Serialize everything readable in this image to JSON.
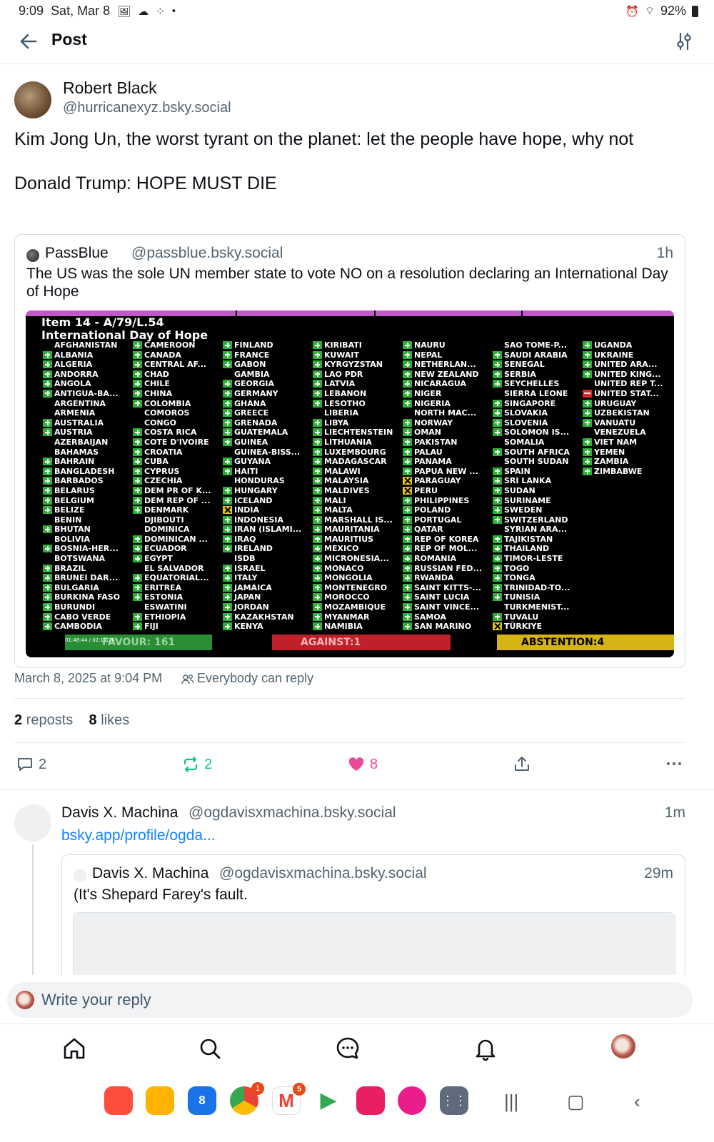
{
  "status_bar": {
    "time": "9:09",
    "date": "Sat, Mar 8",
    "battery": "92%"
  },
  "header": {
    "title": "Post"
  },
  "post": {
    "author_name": "Robert Black",
    "author_handle": "@hurricanexyz.bsky.social",
    "text": "Kim Jong Un, the worst tyrant on the planet: let the people have hope, why not\n\nDonald Trump: HOPE MUST DIE",
    "quote": {
      "name": "PassBlue",
      "handle": "@passblue.bsky.social",
      "time": "1h",
      "text": "The US was the sole UN member state to vote NO on a resolution declaring an International Day of Hope"
    },
    "date": "March 8, 2025 at 9:04 PM",
    "reply_setting": "Everybody can reply",
    "reposts_count": "2",
    "reposts_label": "reposts",
    "likes_count": "8",
    "likes_label": "likes",
    "actions": {
      "replies": "2",
      "reposts": "2",
      "likes": "8"
    }
  },
  "vote_image": {
    "title": "Item 14 - A/79/L.54\nInternational Day of Hope",
    "totals": {
      "favour": "FAVOUR: 161",
      "against": "AGAINST:1",
      "abstention": "ABSTENTION:4"
    },
    "timestamp": "01:48:44 / 02:17:28",
    "columns": [
      [
        [
          "AFGHANISTAN",
          ""
        ],
        [
          "ALBANIA",
          "y"
        ],
        [
          "ALGERIA",
          "y"
        ],
        [
          "ANDORRA",
          "y"
        ],
        [
          "ANGOLA",
          "y"
        ],
        [
          "ANTIGUA-BA...",
          "y"
        ],
        [
          "ARGENTINA",
          ""
        ],
        [
          "ARMENIA",
          ""
        ],
        [
          "AUSTRALIA",
          "y"
        ],
        [
          "AUSTRIA",
          "y"
        ],
        [
          "AZERBAIJAN",
          ""
        ],
        [
          "BAHAMAS",
          ""
        ],
        [
          "BAHRAIN",
          "y"
        ],
        [
          "BANGLADESH",
          "y"
        ],
        [
          "BARBADOS",
          "y"
        ],
        [
          "BELARUS",
          "y"
        ],
        [
          "BELGIUM",
          "y"
        ],
        [
          "BELIZE",
          "y"
        ],
        [
          "BENIN",
          ""
        ],
        [
          "BHUTAN",
          "y"
        ],
        [
          "BOLIVIA",
          ""
        ],
        [
          "BOSNIA-HER...",
          "y"
        ],
        [
          "BOTSWANA",
          ""
        ],
        [
          "BRAZIL",
          "y"
        ],
        [
          "BRUNEI DAR...",
          "y"
        ],
        [
          "BULGARIA",
          "y"
        ],
        [
          "BURKINA FASO",
          "y"
        ],
        [
          "BURUNDI",
          "y"
        ],
        [
          "CABO VERDE",
          "y"
        ],
        [
          "CAMBODIA",
          "y"
        ]
      ],
      [
        [
          "CAMEROON",
          "y"
        ],
        [
          "CANADA",
          "y"
        ],
        [
          "CENTRAL AF...",
          "y"
        ],
        [
          "CHAD",
          "y"
        ],
        [
          "CHILE",
          "y"
        ],
        [
          "CHINA",
          "y"
        ],
        [
          "COLOMBIA",
          "y"
        ],
        [
          "COMOROS",
          ""
        ],
        [
          "CONGO",
          ""
        ],
        [
          "COSTA RICA",
          "y"
        ],
        [
          "COTE D'IVOIRE",
          "y"
        ],
        [
          "CROATIA",
          "y"
        ],
        [
          "CUBA",
          "y"
        ],
        [
          "CYPRUS",
          "y"
        ],
        [
          "CZECHIA",
          "y"
        ],
        [
          "DEM PR OF K...",
          "y"
        ],
        [
          "DEM REP OF ...",
          "y"
        ],
        [
          "DENMARK",
          "y"
        ],
        [
          "DJIBOUTI",
          ""
        ],
        [
          "DOMINICA",
          ""
        ],
        [
          "DOMINICAN ...",
          "y"
        ],
        [
          "ECUADOR",
          "y"
        ],
        [
          "EGYPT",
          "y"
        ],
        [
          "EL SALVADOR",
          ""
        ],
        [
          "EQUATORIAL...",
          "y"
        ],
        [
          "ERITREA",
          "y"
        ],
        [
          "ESTONIA",
          "y"
        ],
        [
          "ESWATINI",
          ""
        ],
        [
          "ETHIOPIA",
          "y"
        ],
        [
          "FIJI",
          "y"
        ]
      ],
      [
        [
          "FINLAND",
          "y"
        ],
        [
          "FRANCE",
          "y"
        ],
        [
          "GABON",
          "y"
        ],
        [
          "GAMBIA",
          ""
        ],
        [
          "GEORGIA",
          "y"
        ],
        [
          "GERMANY",
          "y"
        ],
        [
          "GHANA",
          "y"
        ],
        [
          "GREECE",
          "y"
        ],
        [
          "GRENADA",
          "y"
        ],
        [
          "GUATEMALA",
          "y"
        ],
        [
          "GUINEA",
          "y"
        ],
        [
          "GUINEA-BISS...",
          ""
        ],
        [
          "GUYANA",
          "y"
        ],
        [
          "HAITI",
          "y"
        ],
        [
          "HONDURAS",
          ""
        ],
        [
          "HUNGARY",
          "y"
        ],
        [
          "ICELAND",
          "y"
        ],
        [
          "INDIA",
          "a"
        ],
        [
          "INDONESIA",
          "y"
        ],
        [
          "IRAN (ISLAMI...",
          "y"
        ],
        [
          "IRAQ",
          "y"
        ],
        [
          "IRELAND",
          "y"
        ],
        [
          "ISDB",
          ""
        ],
        [
          "ISRAEL",
          "y"
        ],
        [
          "ITALY",
          "y"
        ],
        [
          "JAMAICA",
          "y"
        ],
        [
          "JAPAN",
          "y"
        ],
        [
          "JORDAN",
          "y"
        ],
        [
          "KAZAKHSTAN",
          "y"
        ],
        [
          "KENYA",
          "y"
        ]
      ],
      [
        [
          "KIRIBATI",
          "y"
        ],
        [
          "KUWAIT",
          "y"
        ],
        [
          "KYRGYZSTAN",
          "y"
        ],
        [
          "LAO PDR",
          "y"
        ],
        [
          "LATVIA",
          "y"
        ],
        [
          "LEBANON",
          "y"
        ],
        [
          "LESOTHO",
          "y"
        ],
        [
          "LIBERIA",
          ""
        ],
        [
          "LIBYA",
          "y"
        ],
        [
          "LIECHTENSTEIN",
          "y"
        ],
        [
          "LITHUANIA",
          "y"
        ],
        [
          "LUXEMBOURG",
          "y"
        ],
        [
          "MADAGASCAR",
          "y"
        ],
        [
          "MALAWI",
          "y"
        ],
        [
          "MALAYSIA",
          "y"
        ],
        [
          "MALDIVES",
          "y"
        ],
        [
          "MALI",
          "y"
        ],
        [
          "MALTA",
          "y"
        ],
        [
          "MARSHALL IS...",
          "y"
        ],
        [
          "MAURITANIA",
          "y"
        ],
        [
          "MAURITIUS",
          "y"
        ],
        [
          "MEXICO",
          "y"
        ],
        [
          "MICRONESIA...",
          "y"
        ],
        [
          "MONACO",
          "y"
        ],
        [
          "MONGOLIA",
          "y"
        ],
        [
          "MONTENEGRO",
          "y"
        ],
        [
          "MOROCCO",
          "y"
        ],
        [
          "MOZAMBIQUE",
          "y"
        ],
        [
          "MYANMAR",
          "y"
        ],
        [
          "NAMIBIA",
          "y"
        ]
      ],
      [
        [
          "NAURU",
          "y"
        ],
        [
          "NEPAL",
          "y"
        ],
        [
          "NETHERLAN...",
          "y"
        ],
        [
          "NEW ZEALAND",
          "y"
        ],
        [
          "NICARAGUA",
          "y"
        ],
        [
          "NIGER",
          "y"
        ],
        [
          "NIGERIA",
          "y"
        ],
        [
          "NORTH MAC...",
          ""
        ],
        [
          "NORWAY",
          "y"
        ],
        [
          "OMAN",
          "y"
        ],
        [
          "PAKISTAN",
          "y"
        ],
        [
          "PALAU",
          "y"
        ],
        [
          "PANAMA",
          "y"
        ],
        [
          "PAPUA NEW ...",
          "y"
        ],
        [
          "PARAGUAY",
          "a"
        ],
        [
          "PERU",
          "a"
        ],
        [
          "PHILIPPINES",
          "y"
        ],
        [
          "POLAND",
          "y"
        ],
        [
          "PORTUGAL",
          "y"
        ],
        [
          "QATAR",
          "y"
        ],
        [
          "REP OF KOREA",
          "y"
        ],
        [
          "REP OF MOL...",
          "y"
        ],
        [
          "ROMANIA",
          "y"
        ],
        [
          "RUSSIAN FED...",
          "y"
        ],
        [
          "RWANDA",
          "y"
        ],
        [
          "SAINT KITTS-...",
          "y"
        ],
        [
          "SAINT LUCIA",
          "y"
        ],
        [
          "SAINT VINCE...",
          "y"
        ],
        [
          "SAMOA",
          "y"
        ],
        [
          "SAN MARINO",
          "y"
        ]
      ],
      [
        [
          "SAO TOME-P...",
          ""
        ],
        [
          "SAUDI ARABIA",
          "y"
        ],
        [
          "SENEGAL",
          "y"
        ],
        [
          "SERBIA",
          "y"
        ],
        [
          "SEYCHELLES",
          "y"
        ],
        [
          "SIERRA LEONE",
          ""
        ],
        [
          "SINGAPORE",
          "y"
        ],
        [
          "SLOVAKIA",
          "y"
        ],
        [
          "SLOVENIA",
          "y"
        ],
        [
          "SOLOMON IS...",
          "y"
        ],
        [
          "SOMALIA",
          ""
        ],
        [
          "SOUTH AFRICA",
          "y"
        ],
        [
          "SOUTH SUDAN",
          ""
        ],
        [
          "SPAIN",
          "y"
        ],
        [
          "SRI LANKA",
          "y"
        ],
        [
          "SUDAN",
          "y"
        ],
        [
          "SURINAME",
          "y"
        ],
        [
          "SWEDEN",
          "y"
        ],
        [
          "SWITZERLAND",
          "y"
        ],
        [
          "SYRIAN ARA...",
          ""
        ],
        [
          "TAJIKISTAN",
          "y"
        ],
        [
          "THAILAND",
          "y"
        ],
        [
          "TIMOR-LESTE",
          "y"
        ],
        [
          "TOGO",
          "y"
        ],
        [
          "TONGA",
          "y"
        ],
        [
          "TRINIDAD-TO...",
          "y"
        ],
        [
          "TUNISIA",
          "y"
        ],
        [
          "TURKMENIST...",
          ""
        ],
        [
          "TUVALU",
          "y"
        ],
        [
          "TÜRKIYE",
          "a"
        ]
      ],
      [
        [
          "UGANDA",
          "y"
        ],
        [
          "UKRAINE",
          "y"
        ],
        [
          "UNITED ARA...",
          "y"
        ],
        [
          "UNITED KING...",
          "y"
        ],
        [
          "UNITED REP T...",
          ""
        ],
        [
          "UNITED STAT...",
          "n"
        ],
        [
          "URUGUAY",
          "y"
        ],
        [
          "UZBEKISTAN",
          "y"
        ],
        [
          "VANUATU",
          "y"
        ],
        [
          "VENEZUELA",
          ""
        ],
        [
          "VIET NAM",
          "y"
        ],
        [
          "YEMEN",
          "y"
        ],
        [
          "ZAMBIA",
          "y"
        ],
        [
          "ZIMBABWE",
          "y"
        ]
      ]
    ]
  },
  "reply_item": {
    "name": "Davis X. Machina",
    "handle": "@ogdavisxmachina.bsky.social",
    "time": "1m",
    "link": "bsky.app/profile/ogda...",
    "quote": {
      "name": "Davis X. Machina",
      "handle": "@ogdavisxmachina.bsky.social",
      "time": "29m",
      "text": "(It's Shepard Farey's fault."
    }
  },
  "reply_bar": {
    "placeholder": "Write your reply"
  },
  "dock": {
    "badges": {
      "chrome": "1",
      "gmail": "5"
    },
    "calendar_day": "8"
  },
  "colors": {
    "accent": "#1083fe",
    "like": "#ec4899",
    "repost": "#13c28e",
    "muted": "#536471"
  }
}
